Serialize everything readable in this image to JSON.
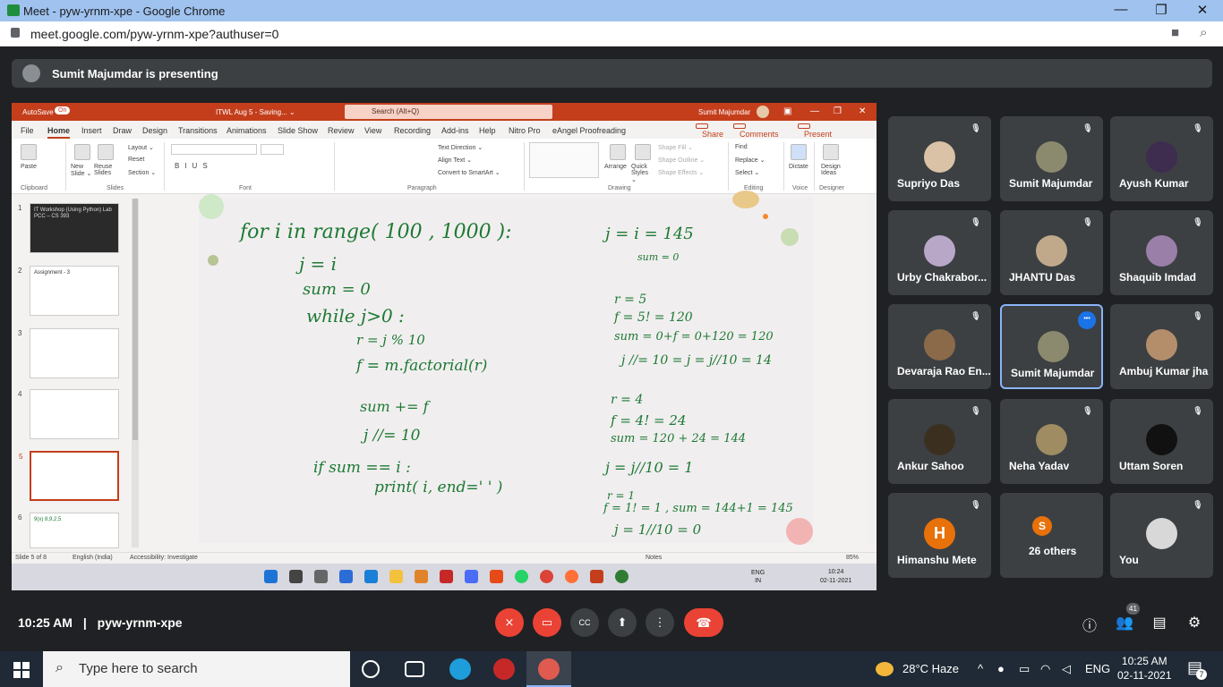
{
  "window": {
    "title": "Meet - pyw-yrnm-xpe - Google Chrome"
  },
  "address": {
    "url": "meet.google.com/pyw-yrnm-xpe?authuser=0"
  },
  "presenting": {
    "text": "Sumit Majumdar is presenting"
  },
  "ppt": {
    "autosave": "AutoSave",
    "autosave_state": "On",
    "doc_title": "ITWL Aug 5 - Saving... ⌄",
    "search_placeholder": "Search (Alt+Q)",
    "user": "Sumit Majumdar",
    "tabs": [
      "File",
      "Home",
      "Insert",
      "Draw",
      "Design",
      "Transitions",
      "Animations",
      "Slide Show",
      "Review",
      "View",
      "Recording",
      "Add-ins",
      "Help",
      "Nitro Pro",
      "eAngel Proofreading"
    ],
    "share": "Share",
    "comments": "Comments",
    "present_teams": "Present in Teams",
    "ribbon": {
      "paste": "Paste",
      "new_slide": "New Slide ⌄",
      "reuse_slides": "Reuse Slides",
      "layout": "Layout ⌄",
      "reset": "Reset",
      "section": "Section ⌄",
      "text_direction": "Text Direction ⌄",
      "align_text": "Align Text ⌄",
      "convert_smartart": "Convert to SmartArt ⌄",
      "arrange": "Arrange",
      "quick_styles": "Quick Styles ⌄",
      "shape_fill": "Shape Fill ⌄",
      "shape_outline": "Shape Outline ⌄",
      "shape_effects": "Shape Effects ⌄",
      "find": "Find",
      "replace": "Replace ⌄",
      "select": "Select ⌄",
      "dictate": "Dictate",
      "design_ideas": "Design Ideas",
      "groups": {
        "clipboard": "Clipboard",
        "slides": "Slides",
        "font": "Font",
        "paragraph": "Paragraph",
        "drawing": "Drawing",
        "editing": "Editing",
        "voice": "Voice",
        "designer": "Designer"
      }
    },
    "thumbs": [
      {
        "n": "1",
        "caption": "IT Workshop (Using Python) Lab\nPCC – CS 393"
      },
      {
        "n": "2",
        "caption": "Assignment - 3"
      },
      {
        "n": "3",
        "caption": ""
      },
      {
        "n": "4",
        "caption": ""
      },
      {
        "n": "5",
        "caption": ""
      },
      {
        "n": "6",
        "caption": "9(x) 8,9,2,5"
      }
    ],
    "slide_ink": {
      "l1": "for  i  in  range( 100 ,  1000 ):",
      "l2": "j = i",
      "l3": "sum = 0",
      "l4": "while  j>0 :",
      "l5": "r = j % 10",
      "l6": "f = m.factorial(r)",
      "l7": "sum += f",
      "l8": "j //= 10",
      "l9": "if  sum == i :",
      "l10": "print( i,  end=' ' )",
      "r1": "j = i = 145",
      "r2": "sum = 0",
      "r3": "r = 5",
      "r4": "f = 5! = 120",
      "r5": "sum = 0+f  =  0+120 = 120",
      "r6": "j //= 10  =  j = j//10 = 14",
      "r7": "r = 4",
      "r8": "f = 4!  =  24",
      "r9": "sum = 120 + 24 = 144",
      "r10": "j = j//10  =  1",
      "r11": "r = 1",
      "r12": "f = 1! = 1 , sum = 144+1 = 145",
      "r13": "j = 1//10 = 0"
    },
    "status": {
      "slide": "Slide 5 of 8",
      "lang": "English (India)",
      "access": "Accessibility: Investigate",
      "notes": "Notes",
      "zoom": "85%"
    },
    "taskbar": {
      "lang": "ENG\nIN",
      "time": "10:24",
      "date": "02-11-2021"
    }
  },
  "participants": [
    {
      "name": "Supriyo Das",
      "muted": true,
      "avatar": "#d9c2a6"
    },
    {
      "name": "Sumit Majumdar",
      "muted": true,
      "avatar": "#8c8a6e"
    },
    {
      "name": "Ayush Kumar",
      "muted": true,
      "avatar": "#3e2d4f"
    },
    {
      "name": "Urby Chakrabor...",
      "muted": true,
      "avatar": "#b9a7c8"
    },
    {
      "name": "JHANTU Das",
      "muted": true,
      "avatar": "#c0a98a"
    },
    {
      "name": "Shaquib Imdad",
      "muted": true,
      "avatar": "#9a7fa8"
    },
    {
      "name": "Devaraja Rao En...",
      "muted": true,
      "avatar": "#8b6a4a"
    },
    {
      "name": "Sumit Majumdar",
      "muted": false,
      "avatar": "#8c8a6e",
      "active": true
    },
    {
      "name": "Ambuj Kumar jha",
      "muted": true,
      "avatar": "#b48e6b"
    },
    {
      "name": "Ankur Sahoo",
      "muted": true,
      "avatar": "#3b3020"
    },
    {
      "name": "Neha Yadav",
      "muted": true,
      "avatar": "#a08c62"
    },
    {
      "name": "Uttam Soren",
      "muted": true,
      "avatar": "#111111"
    },
    {
      "name": "Himanshu Mete",
      "muted": true,
      "initial": "H"
    },
    {
      "name": "26 others",
      "muted": false,
      "initial": "S"
    },
    {
      "name": "You",
      "muted": true,
      "avatar": "#d8d8d8"
    }
  ],
  "meeting": {
    "time": "10:25 AM",
    "sep": "|",
    "code": "pyw-yrnm-xpe",
    "people_count": "41"
  },
  "windows": {
    "search": "Type here to search",
    "weather": "28°C  Haze",
    "lang": "ENG",
    "time": "10:25 AM",
    "date": "02-11-2021",
    "notif": "7"
  }
}
